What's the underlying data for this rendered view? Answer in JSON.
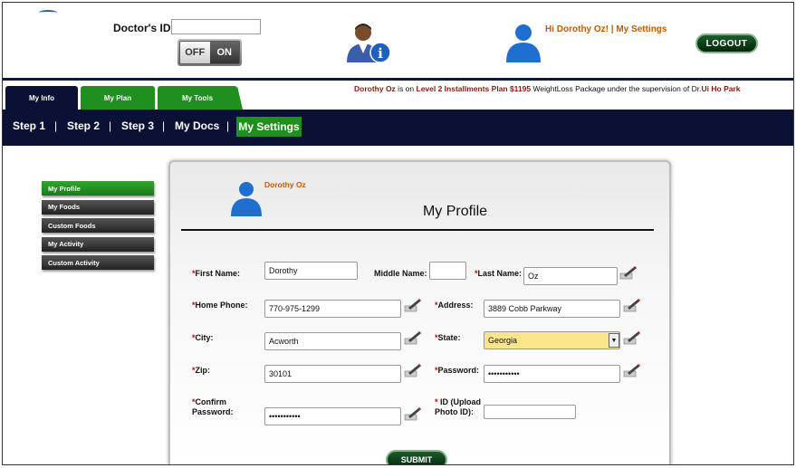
{
  "header": {
    "doctor_id_label": "Doctor's ID:",
    "doctor_id_value": "",
    "toggle": {
      "off_label": "OFF",
      "on_label": "ON"
    },
    "greeting": "Hi Dorothy Oz! | My Settings",
    "logout_label": "LOGOUT",
    "doctor_icon": "doctor-info-icon",
    "user_icon": "user-avatar-icon"
  },
  "tabs": [
    {
      "label": "My Info"
    },
    {
      "label": "My Plan"
    },
    {
      "label": "My Tools"
    }
  ],
  "plan_info": {
    "name": "Dorothy Oz",
    "text1": " is on ",
    "plan": "Level 2 Installments Plan $1195",
    "text2": " WeightLoss Package under the supervision of ",
    "doctor_prefix": "Dr.",
    "doctor": "Ui Ho Park"
  },
  "nav": {
    "step1": "Step 1",
    "step2": "Step 2",
    "step3": "Step 3",
    "docs": "My Docs",
    "settings": "My Settings",
    "sep": "|"
  },
  "sidebar": {
    "items": [
      {
        "label": "My Profile"
      },
      {
        "label": "My Foods"
      },
      {
        "label": "Custom Foods"
      },
      {
        "label": "My Activity"
      },
      {
        "label": "Custom Activity"
      }
    ]
  },
  "profile": {
    "user_name": "Dorothy Oz",
    "title": "My Profile",
    "required_mark": "*",
    "first_name": {
      "label": "First Name:",
      "value": "Dorothy"
    },
    "middle_name": {
      "label": "Middle Name:",
      "value": ""
    },
    "last_name": {
      "label": "Last Name:",
      "value": "Oz"
    },
    "home_phone": {
      "label": "Home Phone:",
      "value": "770-975-1299"
    },
    "address": {
      "label": "Address:",
      "value": "3889 Cobb Parkway"
    },
    "city": {
      "label": "City:",
      "value": "Acworth"
    },
    "state": {
      "label": "State:",
      "value": "Georgia"
    },
    "zip": {
      "label": "Zip:",
      "value": "30101"
    },
    "password": {
      "label": "Password:",
      "value": "•••••••••••"
    },
    "confirm_password": {
      "label_line1": "Confirm",
      "label_line2": "Password:",
      "value": "•••••••••••"
    },
    "photo_id": {
      "label_line1": "ID (Upload",
      "label_line2": "Photo ID):",
      "value": ""
    },
    "submit_label": "SUBMIT",
    "edit_icon": "edit-pencil-icon"
  },
  "colors": {
    "navy": "#0b1135",
    "green": "#1f8f20",
    "orange": "#c45a00",
    "maroon": "#8b1a0f",
    "state_highlight": "#fbe58b"
  }
}
